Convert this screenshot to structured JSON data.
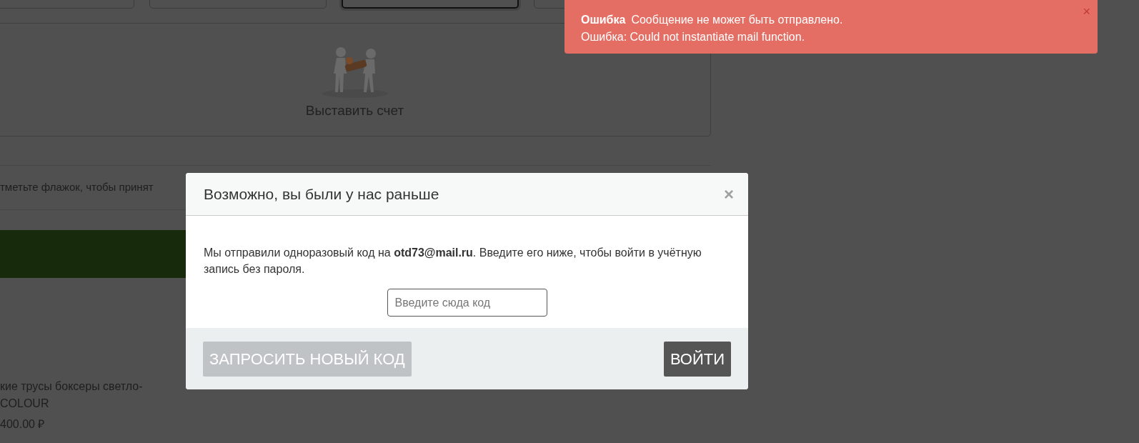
{
  "payment_options": [
    {
      "selected": false
    },
    {
      "selected": false
    },
    {
      "selected": true
    },
    {
      "selected": false
    }
  ],
  "invoice_option": {
    "label": "Выставить счет"
  },
  "agreement": {
    "text": "тметьте флажок, чтобы принят"
  },
  "product": {
    "name_line_1": "кие трусы боксеры светло-",
    "name_line_2": "COLOUR",
    "price": "400.00 ₽"
  },
  "toast": {
    "title": "Ошибка",
    "message": "Сообщение не может быть отправлено.",
    "detail": "Ошибка: Could not instantiate mail function.",
    "close": "×"
  },
  "modal": {
    "title": "Возможно, вы были у нас раньше",
    "close": "×",
    "text": "Мы отправили одноразовый код на **otd73@mail.ru**. Введите его ниже, чтобы войти в учётную запись без пароля.",
    "code_field": {
      "placeholder": "Введите сюда код"
    },
    "buttons": [
      {
        "kind": "secondary",
        "label": "ЗАПРОСИТЬ НОВЫЙ КОД"
      },
      {
        "kind": "primary",
        "label": "ВОЙТИ"
      }
    ]
  }
}
